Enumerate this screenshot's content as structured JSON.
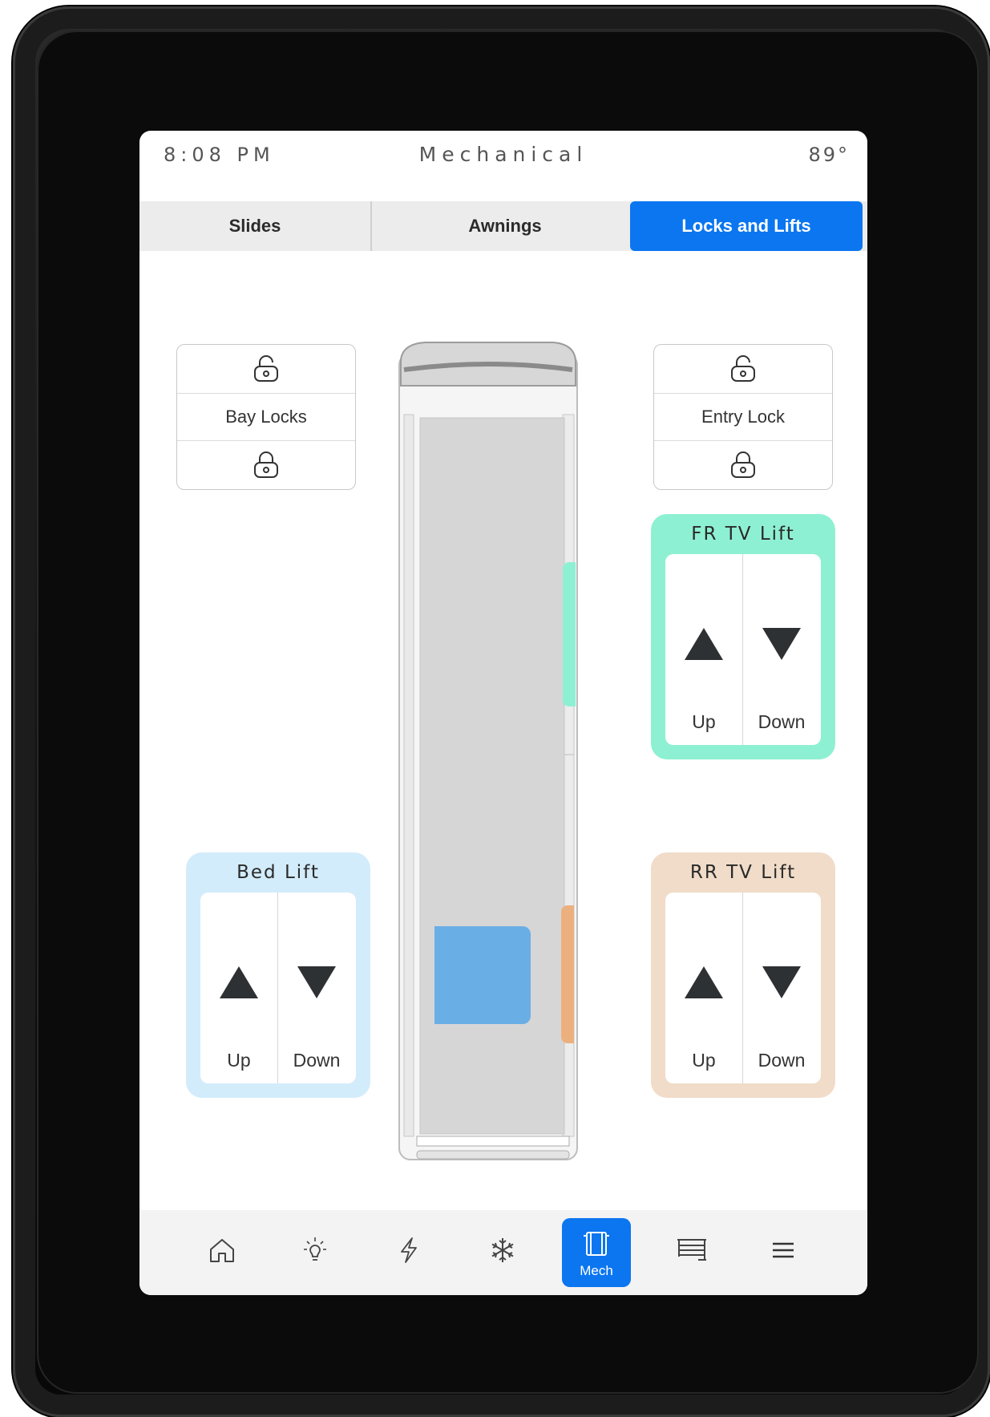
{
  "status": {
    "time": "8:08 PM",
    "title": "Mechanical",
    "temperature": "89°"
  },
  "tabs": [
    {
      "label": "Slides",
      "active": false
    },
    {
      "label": "Awnings",
      "active": false
    },
    {
      "label": "Locks and Lifts",
      "active": true
    }
  ],
  "locks": {
    "bay": {
      "label": "Bay Locks",
      "top_icon": "unlock-icon",
      "bottom_icon": "lock-icon"
    },
    "entry": {
      "label": "Entry Lock",
      "top_icon": "unlock-icon",
      "bottom_icon": "lock-icon"
    }
  },
  "lifts": {
    "fr_tv": {
      "title": "FR TV Lift",
      "up": "Up",
      "down": "Down",
      "color": "#8ef0d2"
    },
    "bed": {
      "title": "Bed Lift",
      "up": "Up",
      "down": "Down",
      "color": "#d3ecfb"
    },
    "rr_tv": {
      "title": "RR TV Lift",
      "up": "Up",
      "down": "Down",
      "color": "#f0dcc8"
    }
  },
  "vehicle_markers": {
    "fr_tv_color": "#8ef0d2",
    "bed_color": "#6aaee6",
    "rr_tv_color": "#ecb07e"
  },
  "nav": {
    "items": [
      {
        "icon": "home-icon",
        "label": ""
      },
      {
        "icon": "lightbulb-icon",
        "label": ""
      },
      {
        "icon": "lightning-icon",
        "label": ""
      },
      {
        "icon": "snowflake-icon",
        "label": ""
      },
      {
        "icon": "mech-icon",
        "label": "Mech",
        "active": true
      },
      {
        "icon": "awning-icon",
        "label": ""
      },
      {
        "icon": "menu-icon",
        "label": ""
      }
    ],
    "active_color": "#0b76f0"
  }
}
